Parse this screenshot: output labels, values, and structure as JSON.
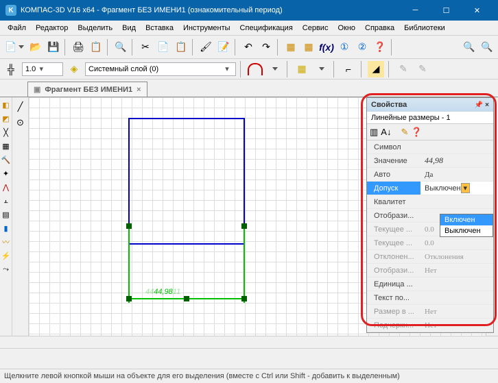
{
  "window": {
    "title": "КОМПАС-3D V16  x64 - Фрагмент БЕЗ ИМЕНИ1 (ознакомительный период)",
    "app_icon": "K"
  },
  "menu": {
    "file": "Файл",
    "edit": "Редактор",
    "select": "Выделить",
    "view": "Вид",
    "insert": "Вставка",
    "tools": "Инструменты",
    "spec": "Спецификация",
    "service": "Сервис",
    "window": "Окно",
    "help": "Справка",
    "libs": "Библиотеки"
  },
  "toolbar": {
    "fx": "f(x)"
  },
  "toolbar2": {
    "scale": "1.0",
    "layer": "Системный слой (0)"
  },
  "tab": {
    "name": "Фрагмент БЕЗ ИМЕНИ1"
  },
  "dim": {
    "value": "44,98",
    "prefix": "44",
    "suffix": "11"
  },
  "props": {
    "title": "Свойства",
    "object": "Линейные размеры - 1",
    "rows": {
      "symbol": "Символ",
      "value_k": "Значение",
      "value_v": "44,98",
      "auto_k": "Авто",
      "auto_v": "Да",
      "tol_k": "Допуск",
      "tol_v": "Выключен",
      "qual_k": "Квалитет",
      "disp_k": "Отобрази...",
      "cur1_k": "Текущее ...",
      "cur1_v": "0.0",
      "cur2_k": "Текущее ...",
      "cur2_v": "0.0",
      "dev_k": "Отклонен...",
      "dev_v": "Отклонения",
      "disp2_k": "Отобрази...",
      "disp2_v": "Нет",
      "unit_k": "Единица ...",
      "text_k": "Текст по...",
      "size_k": "Размер в ...",
      "size_v": "Нет",
      "under_k": "Подчеркн...",
      "under_v": "Нет"
    },
    "dropdown": {
      "on": "Включен",
      "off": "Выключен"
    }
  },
  "status": {
    "text": "Щелкните левой кнопкой мыши на объекте для его выделения (вместе с Ctrl или Shift - добавить к выделенным)"
  }
}
